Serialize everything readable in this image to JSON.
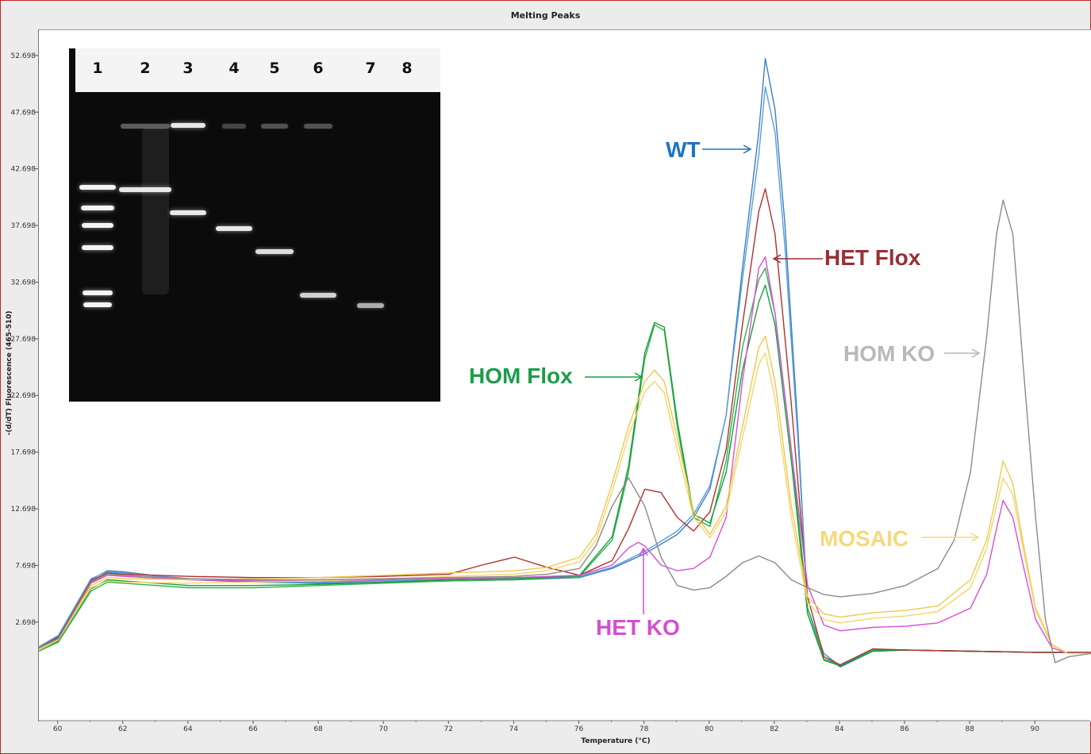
{
  "chart_data": {
    "type": "line",
    "title": "Melting Peaks",
    "xlabel": "Temperature (°C)",
    "ylabel": "-(d/dT) Fluorescence (465-510)",
    "xlim": [
      59.4,
      91.7
    ],
    "ylim": [
      -6.0,
      55.0
    ],
    "xticks": [
      "60",
      "62",
      "64",
      "66",
      "68",
      "70",
      "72",
      "74",
      "76",
      "78",
      "80",
      "82",
      "84",
      "86",
      "88",
      "90"
    ],
    "yticks": [
      "2.698",
      "7.698",
      "12.698",
      "17.698",
      "22.698",
      "27.698",
      "32.698",
      "37.698",
      "42.698",
      "47.698",
      "52.698"
    ],
    "grid": false,
    "legend": "none",
    "series": [
      {
        "color": "#3a7fc4",
        "x": [
          59.4,
          60,
          61,
          61.5,
          62,
          64,
          66,
          68,
          70,
          72,
          74,
          76,
          77,
          78,
          79,
          79.5,
          80,
          80.5,
          81,
          81.5,
          81.7,
          82,
          82.3,
          82.7,
          83,
          83.5,
          84,
          84.5,
          85,
          86,
          88,
          90,
          91,
          91.7
        ],
        "y": [
          0.5,
          1.5,
          6.5,
          7.3,
          7.2,
          6.5,
          6.3,
          6.2,
          6.3,
          6.4,
          6.5,
          6.7,
          7.5,
          8.8,
          10.5,
          12,
          14.5,
          21,
          34,
          46,
          52.5,
          48,
          38,
          20,
          4,
          0,
          -1.2,
          -0.5,
          0.2,
          0.3,
          0.2,
          0.1,
          0.1,
          0.1
        ]
      },
      {
        "color": "#5a9ed9",
        "x": [
          59.4,
          60,
          61,
          61.5,
          62,
          64,
          66,
          68,
          70,
          72,
          74,
          76,
          77,
          78,
          79,
          79.5,
          80,
          80.5,
          81,
          81.5,
          81.7,
          82,
          82.3,
          82.7,
          83,
          83.5,
          84,
          84.5,
          85,
          86,
          88,
          90,
          91,
          91.7
        ],
        "y": [
          0.6,
          1.6,
          6.6,
          7.2,
          7.1,
          6.6,
          6.4,
          6.3,
          6.4,
          6.5,
          6.6,
          6.8,
          7.6,
          9.0,
          10.8,
          12.3,
          14.8,
          21,
          33,
          44,
          50,
          46,
          36,
          19,
          4,
          0,
          -1.1,
          -0.4,
          0.3,
          0.3,
          0.2,
          0.1,
          0.1,
          0.1
        ]
      },
      {
        "color": "#2db34a",
        "x": [
          59.4,
          60,
          61,
          61.5,
          62,
          64,
          66,
          68,
          70,
          72,
          74,
          76,
          77,
          77.5,
          78,
          78.3,
          78.6,
          79,
          79.5,
          80,
          80.5,
          81,
          81.5,
          81.7,
          82,
          82.5,
          83,
          83.5,
          84,
          85,
          86,
          88,
          90,
          91,
          91.7
        ],
        "y": [
          0.2,
          1,
          5.5,
          6.3,
          6.2,
          5.8,
          5.8,
          6,
          6.2,
          6.4,
          6.5,
          6.8,
          10,
          16,
          26,
          29,
          28.5,
          20,
          12,
          11.2,
          17,
          27,
          33,
          34,
          30,
          18,
          4,
          -0.5,
          -1,
          0.3,
          0.3,
          0.2,
          0.1,
          0.1,
          0.1
        ]
      },
      {
        "color": "#1a9e3c",
        "x": [
          59.4,
          60,
          61,
          61.5,
          62,
          64,
          66,
          68,
          70,
          72,
          74,
          76,
          77,
          77.5,
          78,
          78.3,
          78.6,
          79,
          79.5,
          80,
          80.5,
          81,
          81.5,
          81.7,
          82,
          82.5,
          83,
          83.5,
          84,
          85,
          86,
          88,
          90,
          91,
          91.7
        ],
        "y": [
          0.3,
          1.1,
          5.7,
          6.5,
          6.4,
          6.0,
          6.0,
          6.1,
          6.3,
          6.5,
          6.6,
          6.9,
          10.3,
          16.5,
          26.5,
          29.2,
          28.8,
          20.5,
          12.3,
          11.5,
          16,
          25,
          31,
          32.5,
          29,
          17,
          3.5,
          -0.6,
          -1.1,
          0.2,
          0.3,
          0.2,
          0.1,
          0.1,
          0.1
        ]
      },
      {
        "color": "#b03030",
        "x": [
          59.4,
          60,
          61,
          61.5,
          62,
          64,
          66,
          68,
          70,
          72,
          73,
          74,
          75,
          76,
          77,
          77.5,
          78,
          78.5,
          79,
          79.5,
          80,
          80.5,
          81,
          81.5,
          81.7,
          82,
          82.5,
          83,
          83.5,
          84,
          85,
          86,
          88,
          90,
          91,
          91.7
        ],
        "y": [
          0.5,
          1.4,
          6.4,
          7.1,
          7,
          6.8,
          6.7,
          6.7,
          6.8,
          7.0,
          7.8,
          8.5,
          7.6,
          6.9,
          8.2,
          11,
          14.5,
          14.2,
          12,
          10.8,
          12.5,
          18,
          29,
          39,
          41,
          37,
          22,
          5,
          -0.3,
          -1,
          0.4,
          0.3,
          0.2,
          0.1,
          0.1,
          0.1
        ]
      },
      {
        "color": "#d94fd4",
        "x": [
          59.4,
          60,
          61,
          61.5,
          62,
          64,
          66,
          68,
          70,
          72,
          74,
          76,
          77,
          77.5,
          77.8,
          78,
          78.5,
          79,
          79.5,
          80,
          80.5,
          81,
          81.5,
          81.7,
          82,
          82.5,
          83,
          83.5,
          84,
          85,
          86,
          87,
          88,
          88.5,
          88.8,
          89,
          89.3,
          89.6,
          90,
          90.5,
          91,
          91.7
        ],
        "y": [
          0.4,
          1.3,
          6.2,
          6.9,
          6.8,
          6.5,
          6.4,
          6.4,
          6.5,
          6.6,
          6.7,
          6.9,
          7.8,
          9.3,
          9.8,
          9.5,
          7.8,
          7.3,
          7.5,
          8.5,
          12,
          24,
          34,
          35,
          30,
          18,
          6,
          2.5,
          2,
          2.3,
          2.4,
          2.7,
          4,
          7,
          11,
          13.5,
          12,
          8,
          3,
          0.5,
          0,
          0
        ]
      },
      {
        "color": "#f0c84a",
        "x": [
          59.4,
          60,
          61,
          61.5,
          62,
          64,
          66,
          68,
          70,
          72,
          74,
          75,
          76,
          76.5,
          77,
          77.5,
          78,
          78.3,
          78.6,
          79,
          79.5,
          80,
          80.5,
          81,
          81.5,
          81.7,
          82,
          82.5,
          83,
          83.5,
          84,
          85,
          86,
          87,
          88,
          88.5,
          88.8,
          89,
          89.3,
          89.6,
          90,
          90.5,
          91,
          91.7
        ],
        "y": [
          0.4,
          1.3,
          6.0,
          6.7,
          6.6,
          6.5,
          6.6,
          6.7,
          6.9,
          7.1,
          7.3,
          7.6,
          8.5,
          10.5,
          15,
          20,
          24,
          25,
          24,
          19,
          12.5,
          10.5,
          13,
          20,
          27,
          28,
          24,
          13,
          5,
          3.5,
          3.2,
          3.6,
          3.8,
          4.2,
          6.5,
          10,
          14,
          17,
          15,
          10,
          4,
          0.8,
          0,
          0
        ]
      },
      {
        "color": "#f5d56e",
        "x": [
          59.4,
          60,
          61,
          61.5,
          62,
          64,
          66,
          68,
          70,
          72,
          74,
          75,
          76,
          76.5,
          77,
          77.5,
          78,
          78.3,
          78.6,
          79,
          79.5,
          80,
          80.5,
          81,
          81.5,
          81.7,
          82,
          82.5,
          83,
          83.5,
          84,
          85,
          86,
          87,
          88,
          88.5,
          88.8,
          89,
          89.3,
          89.6,
          90,
          90.5,
          91,
          91.7
        ],
        "y": [
          0.3,
          1.2,
          5.8,
          6.4,
          6.3,
          6.2,
          6.3,
          6.4,
          6.6,
          6.8,
          7.0,
          7.3,
          8.1,
          10,
          14.3,
          19.2,
          23.1,
          24,
          23,
          18,
          12,
          10.2,
          12.5,
          19,
          25.5,
          26.5,
          22.5,
          12,
          4.5,
          3,
          2.7,
          3.1,
          3.3,
          3.7,
          5.8,
          9.3,
          13,
          15.5,
          14,
          9.5,
          3.8,
          0.7,
          0,
          0
        ]
      },
      {
        "color": "#8a8a8a",
        "x": [
          59.4,
          60,
          61,
          61.5,
          62,
          64,
          66,
          68,
          70,
          72,
          74,
          75,
          76,
          76.5,
          77,
          77.5,
          78,
          78.5,
          79,
          79.5,
          80,
          80.5,
          81,
          81.5,
          82,
          82.5,
          83,
          83.5,
          84,
          85,
          86,
          87,
          87.5,
          88,
          88.5,
          88.8,
          89,
          89.3,
          89.6,
          90,
          90.3,
          90.6,
          91,
          91.7
        ],
        "y": [
          0.5,
          1.3,
          6.3,
          7.0,
          6.9,
          6.6,
          6.5,
          6.5,
          6.6,
          6.7,
          6.8,
          7.0,
          7.5,
          9.5,
          13,
          15.5,
          13,
          8.5,
          6,
          5.6,
          5.8,
          6.8,
          8.0,
          8.6,
          8.0,
          6.5,
          5.8,
          5.2,
          5.0,
          5.3,
          6.0,
          7.5,
          10,
          16,
          28,
          37,
          40,
          37,
          26,
          12,
          3,
          -0.8,
          -0.3,
          0
        ]
      }
    ],
    "annotations": [
      {
        "label": "WT",
        "color": "#1f74c4"
      },
      {
        "label": "HET Flox",
        "color": "#9a2f33"
      },
      {
        "label": "HOM Flox",
        "color": "#1f9c49"
      },
      {
        "label": "HOM KO",
        "color": "#b8b8b8"
      },
      {
        "label": "MOSAIC",
        "color": "#f6d97a"
      },
      {
        "label": "HET KO",
        "color": "#d44fd0"
      }
    ],
    "gel_lanes": [
      "1",
      "2",
      "3",
      "4",
      "5",
      "6",
      "7",
      "8"
    ]
  }
}
